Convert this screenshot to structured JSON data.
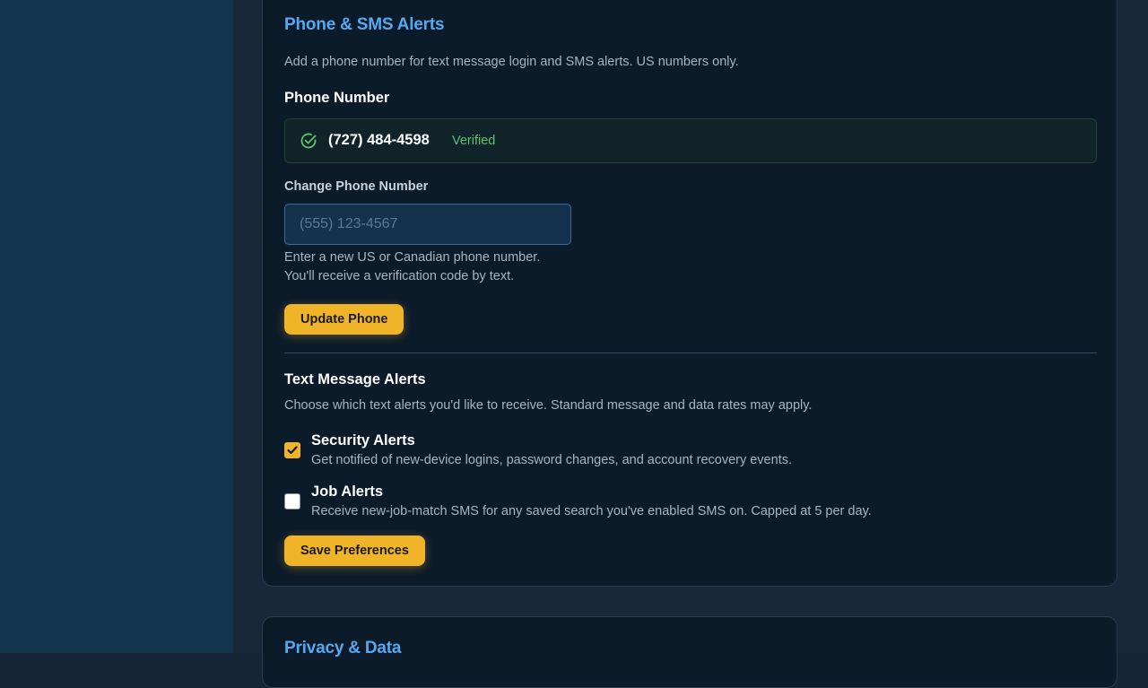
{
  "sms_card": {
    "title": "Phone & SMS Alerts",
    "description": "Add a phone number for text message login and SMS alerts. US numbers only.",
    "phone_label": "Phone Number",
    "current_phone": "(727) 484-4598",
    "verified_label": "Verified",
    "change_label": "Change Phone Number",
    "change_placeholder": "(555) 123-4567",
    "change_value": "",
    "help_line1": "Enter a new US or Canadian phone number.",
    "help_line2": "You'll receive a verification code by text.",
    "update_button": "Update Phone",
    "alerts_title": "Text Message Alerts",
    "alerts_description": "Choose which text alerts you'd like to receive. Standard message and data rates may apply.",
    "alerts": [
      {
        "title": "Security Alerts",
        "description": "Get notified of new-device logins, password changes, and account recovery events.",
        "checked": true
      },
      {
        "title": "Job Alerts",
        "description": "Receive new-job-match SMS for any saved search you've enabled SMS on. Capped at 5 per day.",
        "checked": false
      }
    ],
    "save_button": "Save Preferences"
  },
  "privacy_card": {
    "title": "Privacy & Data"
  },
  "colors": {
    "accent": "#f0b429",
    "title_blue": "#58a8f0",
    "verified_green": "#5cc36e",
    "card_bg": "#0c1b2a"
  }
}
